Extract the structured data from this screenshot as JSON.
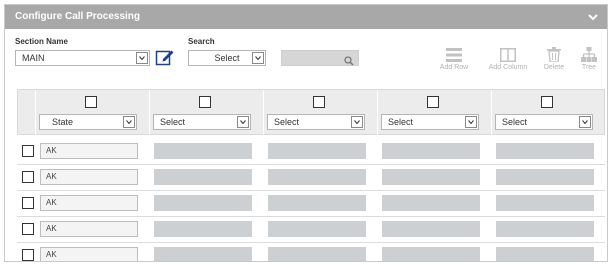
{
  "header": {
    "title": "Configure Call Processing"
  },
  "section": {
    "label": "Section Name",
    "value": "MAIN"
  },
  "search": {
    "label": "Search",
    "select_value": "Select",
    "query": ""
  },
  "toolbar": {
    "add_row": "Add Row",
    "add_column": "Add Column",
    "delete": "Delete",
    "tree": "Tree"
  },
  "grid": {
    "column_selects": [
      "State",
      "Select",
      "Select",
      "Select",
      "Select"
    ],
    "rows": [
      "AK",
      "AK",
      "AK",
      "AK",
      "AK"
    ]
  },
  "colors": {
    "header_bg": "#a8a8a8",
    "cell_fill": "#cdd0d2",
    "toolbar_disabled": "#b2b2b2",
    "edit_icon": "#1f3f8f"
  }
}
